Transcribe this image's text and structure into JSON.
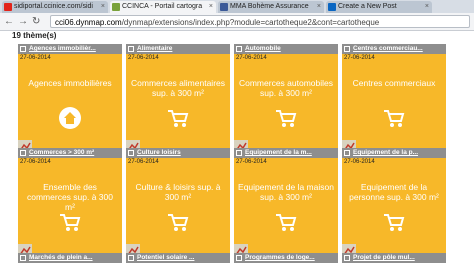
{
  "browser": {
    "tabs": [
      {
        "label": "sidiportal.ccinice.com/sidi"
      },
      {
        "label": "CCINCA - Portail cartogra"
      },
      {
        "label": "MMA Bohème Assurance"
      },
      {
        "label": "Create a New Post"
      }
    ],
    "url_host": "cci06.dynmap.com",
    "url_path": "/dynmap/extensions/index.php?module=cartotheque2&cont=cartotheque",
    "colors": {
      "tab_facebook": "#3b5998",
      "tab_linkedin": "#0a66c2",
      "tab_site": "#e2231a"
    }
  },
  "page": {
    "count_label": "19 thème(s)",
    "tiles_row1": [
      {
        "header": "Agences immobilièr...",
        "date": "27-06-2014",
        "title": "Agences immobilières",
        "icon": "house-icon"
      },
      {
        "header": "Alimentaire",
        "date": "27-06-2014",
        "title": "Commerces alimentaires sup. à 300 m²",
        "icon": "cart-icon"
      },
      {
        "header": "Automobile",
        "date": "27-06-2014",
        "title": "Commerces automobiles sup. à 300 m²",
        "icon": "cart-icon"
      },
      {
        "header": "Centres commerciau...",
        "date": "27-06-2014",
        "title": "Centres commerciaux",
        "icon": "cart-icon"
      }
    ],
    "tiles_row2": [
      {
        "header": "Commerces > 300 m²",
        "date": "27-06-2014",
        "title": "Ensemble des commerces sup. à 300 m²",
        "icon": "cart-icon"
      },
      {
        "header": "Culture loisirs",
        "date": "27-06-2014",
        "title": "Culture & loisirs sup. à 300 m²",
        "icon": "cart-icon"
      },
      {
        "header": "Equipement de la m...",
        "date": "27-06-2014",
        "title": "Equipement de la maison sup. à 300 m²",
        "icon": "cart-icon"
      },
      {
        "header": "Equipement de la p...",
        "date": "27-06-2014",
        "title": "Equipement de la personne sup. à 300 m²",
        "icon": "cart-icon"
      }
    ],
    "tiles_row3": [
      {
        "header": "Marchés de plein a..."
      },
      {
        "header": "Potentiel solaire ..."
      },
      {
        "header": "Programmes de loge..."
      },
      {
        "header": "Projet de pôle mul..."
      }
    ],
    "colors": {
      "tile": "#f7b829",
      "header": "#8e8e8e"
    }
  }
}
